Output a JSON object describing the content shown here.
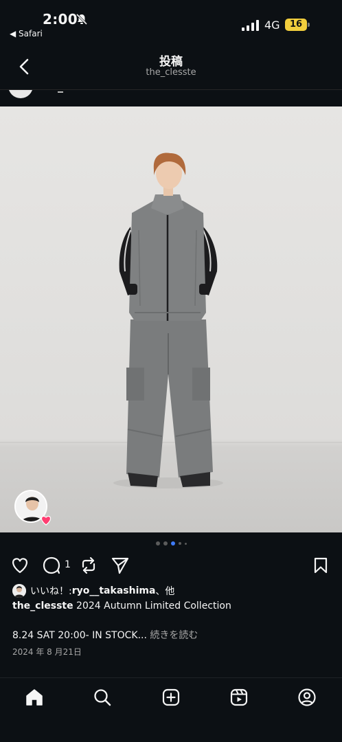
{
  "status_bar": {
    "time": "2:00",
    "back_app": "◀ Safari",
    "network": "4G",
    "battery": "16"
  },
  "header": {
    "title": "投稿",
    "subtitle": "the_clesste"
  },
  "post": {
    "carousel": {
      "count": 5,
      "active_index": 2
    },
    "comment_count": "1",
    "likes_prefix": "いいね！: ",
    "likes_user": "ryo__takashima",
    "likes_suffix": "、他",
    "caption_user": "the_clesste",
    "caption_text": " 2024 Autumn Limited Collection",
    "caption_line2": "8.24 SAT 20:00- IN STOCK...",
    "more_label": " 続きを読む",
    "date": "2024 年 8 月21日"
  },
  "colors": {
    "background": "#0c1014",
    "accent_dot": "#3f7bf6",
    "battery": "#f2ce3d",
    "heart_badge": "#ff3d71"
  },
  "icons": {
    "back": "chevron-left-icon",
    "like": "heart-icon",
    "comment": "comment-icon",
    "repost": "repost-icon",
    "share": "send-icon",
    "save": "bookmark-icon",
    "home": "home-icon",
    "search": "search-icon",
    "create": "plus-square-icon",
    "reels": "reels-icon",
    "profile": "profile-icon"
  }
}
